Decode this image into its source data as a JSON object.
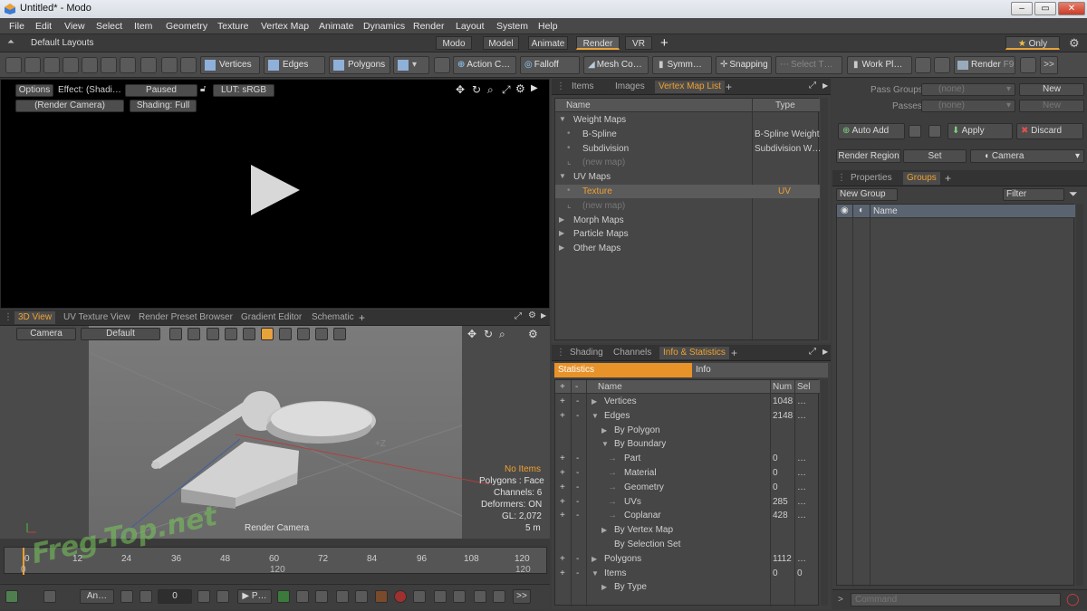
{
  "window": {
    "title": "Untitled* - Modo",
    "controls": [
      "–",
      "▭",
      "✕"
    ]
  },
  "menu": [
    "File",
    "Edit",
    "View",
    "Select",
    "Item",
    "Geometry",
    "Texture",
    "Vertex Map",
    "Animate",
    "Dynamics",
    "Render",
    "Layout",
    "System",
    "Help"
  ],
  "layout": {
    "default_layouts": "Default Layouts",
    "tabs": [
      "Modo",
      "Model",
      "Animate",
      "Render",
      "VR"
    ],
    "active_tab": "Render",
    "add": "+",
    "only": "Only",
    "star": "★"
  },
  "toolbar": {
    "vertices": "Vertices",
    "edges": "Edges",
    "polygons": "Polygons",
    "action_center": "Action C…",
    "falloff": "Falloff",
    "mesh_constraint": "Mesh Co…",
    "symmetry": "Symm…",
    "snapping": "Snapping",
    "select_through": "Select T…",
    "work_plane": "Work Pl…",
    "render": "Render",
    "render_key": "F9",
    "more": ">>"
  },
  "render_view": {
    "options": "Options",
    "effect": "Effect: (Shadi…",
    "paused": "Paused",
    "lut": "LUT: sRGB",
    "camera": "(Render Camera)",
    "shading": "Shading: Full"
  },
  "view_tabs": {
    "tabs": [
      "3D View",
      "UV Texture View",
      "Render Preset Browser",
      "Gradient Editor",
      "Schematic"
    ],
    "active": "3D View",
    "add": "+"
  },
  "view3d": {
    "camera": "Camera",
    "default": "Default",
    "axis_label": "+Z",
    "render_camera": "Render Camera",
    "info": [
      "No Items",
      "Polygons : Face",
      "Channels: 6",
      "Deformers: ON",
      "GL: 2,072",
      "5 m"
    ]
  },
  "timeline": {
    "ticks": [
      "0",
      "12",
      "24",
      "36",
      "48",
      "60",
      "72",
      "84",
      "96",
      "108",
      "120"
    ],
    "range_start": "0",
    "range_mid": "120",
    "range_end": "120",
    "frame": "0",
    "anim_label": "An…",
    "play_label": "P…",
    "watermark": "Freg-Top.net"
  },
  "vmap_panel": {
    "tabs": [
      "Items",
      "Images",
      "Vertex Map List"
    ],
    "active": "Vertex Map List",
    "add": "+",
    "col_name": "Name",
    "col_type": "Type",
    "rows": [
      {
        "name": "Weight Maps",
        "type": "",
        "indent": 0,
        "arrow": "▼",
        "style": "normal"
      },
      {
        "name": "B-Spline",
        "type": "B-Spline Weight",
        "indent": 1,
        "arrow": "",
        "style": "normal"
      },
      {
        "name": "Subdivision",
        "type": "Subdivision W…",
        "indent": 1,
        "arrow": "",
        "style": "normal"
      },
      {
        "name": "(new map)",
        "type": "",
        "indent": 1,
        "arrow": "",
        "style": "dim"
      },
      {
        "name": "UV Maps",
        "type": "",
        "indent": 0,
        "arrow": "▼",
        "style": "normal"
      },
      {
        "name": "Texture",
        "type": "UV",
        "indent": 1,
        "arrow": "",
        "style": "selected"
      },
      {
        "name": "(new map)",
        "type": "",
        "indent": 1,
        "arrow": "",
        "style": "dim"
      },
      {
        "name": "Morph Maps",
        "type": "",
        "indent": 0,
        "arrow": "▶",
        "style": "normal"
      },
      {
        "name": "Particle Maps",
        "type": "",
        "indent": 0,
        "arrow": "▶",
        "style": "normal"
      },
      {
        "name": "Other Maps",
        "type": "",
        "indent": 0,
        "arrow": "▶",
        "style": "normal"
      }
    ]
  },
  "stats_panel": {
    "tabs": [
      "Shading",
      "Channels",
      "Info & Statistics"
    ],
    "active": "Info & Statistics",
    "add": "+",
    "sub_tabs": [
      "Statistics",
      "Info"
    ],
    "col_name": "Name",
    "col_num": "Num",
    "col_sel": "Sel",
    "rows": [
      {
        "name": "Vertices",
        "num": "1048",
        "sel": "…",
        "indent": 0,
        "arrow": "▶",
        "pm": true
      },
      {
        "name": "Edges",
        "num": "2148",
        "sel": "…",
        "indent": 0,
        "arrow": "▼",
        "pm": true
      },
      {
        "name": "By Polygon",
        "num": "",
        "sel": "",
        "indent": 1,
        "arrow": "▶",
        "pm": false
      },
      {
        "name": "By Boundary",
        "num": "",
        "sel": "",
        "indent": 1,
        "arrow": "▼",
        "pm": false
      },
      {
        "name": "Part",
        "num": "0",
        "sel": "…",
        "indent": 2,
        "arrow": "",
        "pm": true
      },
      {
        "name": "Material",
        "num": "0",
        "sel": "…",
        "indent": 2,
        "arrow": "",
        "pm": true
      },
      {
        "name": "Geometry",
        "num": "0",
        "sel": "…",
        "indent": 2,
        "arrow": "",
        "pm": true
      },
      {
        "name": "UVs",
        "num": "285",
        "sel": "…",
        "indent": 2,
        "arrow": "",
        "pm": true
      },
      {
        "name": "Coplanar",
        "num": "428",
        "sel": "…",
        "indent": 2,
        "arrow": "",
        "pm": true
      },
      {
        "name": "By Vertex Map",
        "num": "",
        "sel": "",
        "indent": 1,
        "arrow": "▶",
        "pm": false
      },
      {
        "name": "By Selection Set",
        "num": "",
        "sel": "",
        "indent": 1,
        "arrow": "",
        "pm": false
      },
      {
        "name": "Polygons",
        "num": "1112",
        "sel": "…",
        "indent": 0,
        "arrow": "▶",
        "pm": true
      },
      {
        "name": "Items",
        "num": "0",
        "sel": "0",
        "indent": 0,
        "arrow": "▼",
        "pm": true
      },
      {
        "name": "By Type",
        "num": "",
        "sel": "",
        "indent": 1,
        "arrow": "▶",
        "pm": false
      }
    ]
  },
  "pass_panel": {
    "pass_groups": "Pass Groups",
    "passes": "Passes",
    "none1": "(none)",
    "none2": "(none)",
    "new1": "New",
    "new2": "New",
    "auto_add": "Auto Add",
    "apply": "Apply",
    "discard": "Discard",
    "render_region": "Render Region",
    "set": "Set",
    "camera": "Camera"
  },
  "groups_panel": {
    "tabs": [
      "Properties",
      "Groups"
    ],
    "active": "Groups",
    "add": "+",
    "new_group": "New Group",
    "filter": "Filter",
    "col_name": "Name"
  },
  "command": {
    "placeholder": "Command"
  }
}
